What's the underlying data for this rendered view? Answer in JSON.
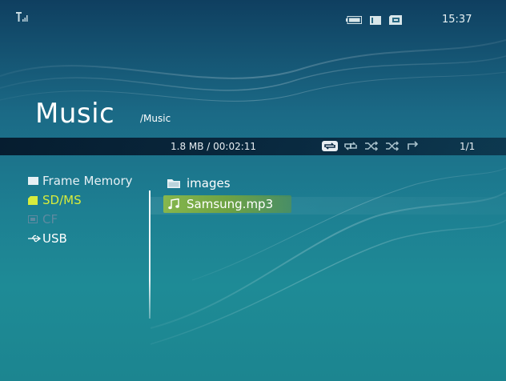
{
  "status_bar": {
    "clock": "15:37",
    "icons": [
      "signal-icon",
      "battery-icon",
      "memory-card-icon",
      "sd-card-status-icon"
    ]
  },
  "header": {
    "title": "Music",
    "path": "/Music"
  },
  "info_bar": {
    "file_info": "1.8 MB / 00:02:11",
    "page": "1/1",
    "play_modes": [
      "repeat-one-icon",
      "repeat-all-icon",
      "shuffle-icon",
      "shuffle-repeat-icon",
      "return-icon"
    ]
  },
  "sources": [
    {
      "label": "Frame Memory",
      "icon": "frame-memory-icon",
      "state": "normal"
    },
    {
      "label": "SD/MS",
      "icon": "sd-card-icon",
      "state": "selected"
    },
    {
      "label": "CF",
      "icon": "cf-card-icon",
      "state": "disabled"
    },
    {
      "label": "USB",
      "icon": "usb-icon",
      "state": "normal"
    }
  ],
  "files": [
    {
      "label": "images",
      "icon": "folder-icon"
    },
    {
      "label": "Samsung.mp3",
      "icon": "music-note-icon",
      "selected": true
    }
  ],
  "colors": {
    "selected_source": "#d6ec3c",
    "selected_file": "#78aa46",
    "disabled_source": "#5d8aa0",
    "info_bar": "#061e34"
  }
}
